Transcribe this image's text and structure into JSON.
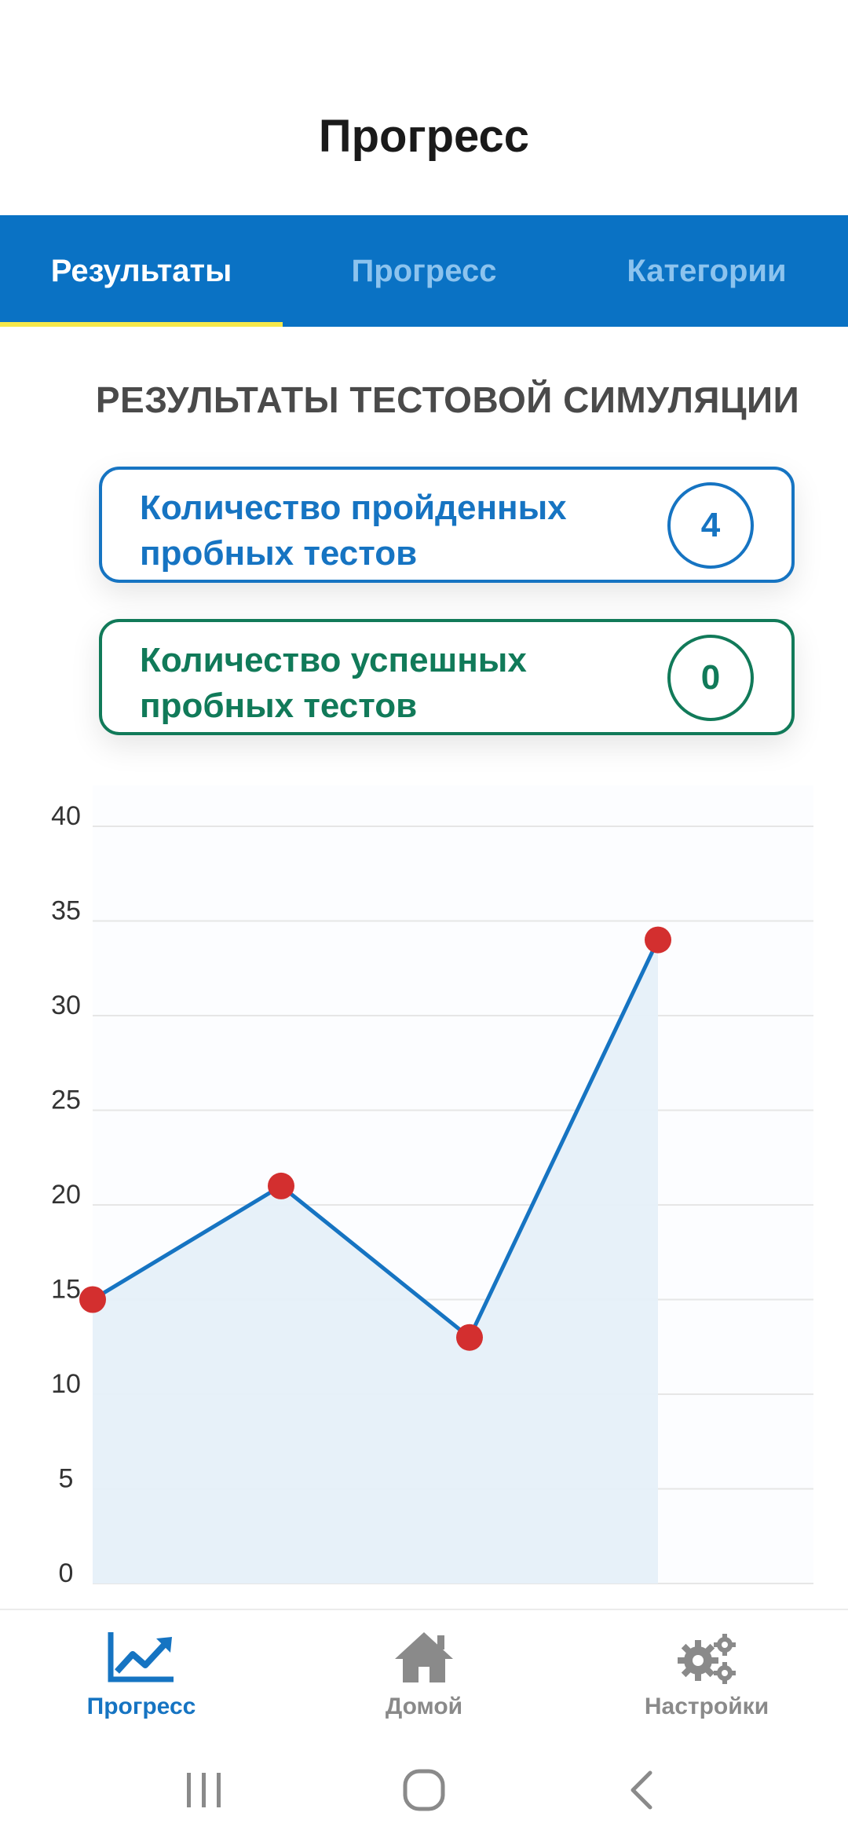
{
  "header": {
    "title": "Прогресс"
  },
  "tabs": [
    {
      "label": "Результаты",
      "active": true
    },
    {
      "label": "Прогресс",
      "active": false
    },
    {
      "label": "Категории",
      "active": false
    }
  ],
  "results": {
    "section_title": "РЕЗУЛЬТАТЫ ТЕСТОВОЙ СИМУЛЯЦИИ",
    "cards": [
      {
        "label": "Количество пройденных пробных тестов",
        "value": "4",
        "color": "#1674c2"
      },
      {
        "label": "Количество успешных пробных тестов",
        "value": "0",
        "color": "#117a59"
      }
    ]
  },
  "chart_data": {
    "type": "area",
    "x": [
      1,
      2,
      3,
      4
    ],
    "series": [
      {
        "values": [
          15,
          21,
          13,
          34
        ]
      }
    ],
    "ylim": [
      0,
      40
    ],
    "yticks": [
      0,
      5,
      10,
      15,
      20,
      25,
      30,
      35,
      40
    ],
    "grid": true,
    "colors": {
      "line": "#1674c2",
      "fill": "#e6f0f9",
      "marker": "#d32f2f",
      "grid": "#e6e6e6"
    }
  },
  "bottom_nav": {
    "items": [
      {
        "label": "Прогресс",
        "icon": "trending-up-icon",
        "active": true
      },
      {
        "label": "Домой",
        "icon": "home-icon",
        "active": false
      },
      {
        "label": "Настройки",
        "icon": "gears-icon",
        "active": false
      }
    ]
  },
  "system_nav": {
    "icons": [
      "recent-apps-icon",
      "home-circle-icon",
      "back-icon"
    ]
  },
  "colors": {
    "brand": "#0a72c4",
    "tab_indicator": "#f6e84a",
    "success": "#117a59"
  }
}
